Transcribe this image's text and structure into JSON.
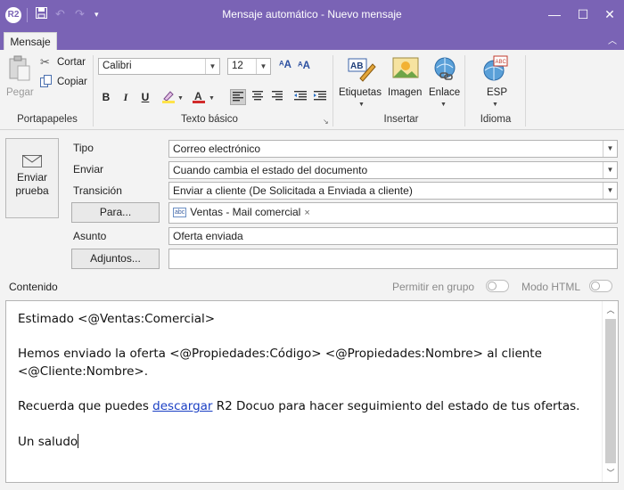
{
  "window": {
    "title": "Mensaje automático - Nuevo mensaje",
    "app_icon_text": "R2",
    "accent_color": "#7a63b5"
  },
  "qat": {
    "save_icon": "save-icon",
    "undo_icon": "undo-icon",
    "redo_icon": "redo-icon",
    "customize_icon": "chevron-down-icon"
  },
  "ribbon": {
    "active_tab": "Mensaje",
    "clipboard": {
      "paste": "Pegar",
      "cut": "Cortar",
      "copy": "Copiar",
      "label": "Portapapeles"
    },
    "basic_text": {
      "font": "Calibri",
      "size": "12",
      "label": "Texto básico",
      "bold": "B",
      "italic": "I",
      "underline": "U"
    },
    "insert": {
      "tags": "Etiquetas",
      "image": "Imagen",
      "link": "Enlace",
      "label": "Insertar"
    },
    "language": {
      "lang": "ESP",
      "label": "Idioma"
    }
  },
  "form": {
    "send_test": {
      "line1": "Enviar",
      "line2": "prueba"
    },
    "type_label": "Tipo",
    "type_value": "Correo electrónico",
    "send_label": "Enviar",
    "send_value": "Cuando cambia el estado del documento",
    "transition_label": "Transición",
    "transition_value": "Enviar a cliente (De Solicitada a Enviada a cliente)",
    "to_button": "Para...",
    "recipient": "Ventas - Mail comercial",
    "recipient_tag": "abc",
    "subject_label": "Asunto",
    "subject_value": "Oferta enviada",
    "attach_button": "Adjuntos...",
    "attach_value": ""
  },
  "content": {
    "label": "Contenido",
    "group_toggle": "Permitir en grupo",
    "html_toggle": "Modo HTML",
    "line1": "Estimado  <@Ventas:Comercial>",
    "line2": "Hemos enviado la oferta  <@Propiedades:Código> <@Propiedades:Nombre> al cliente",
    "line3": "<@Cliente:Nombre>.",
    "line4_pre": "Recuerda que puedes ",
    "line4_link": "descargar",
    "line4_post": "  R2 Docuo para hacer seguimiento del estado de tus ofertas.",
    "line5": "Un saludo"
  }
}
